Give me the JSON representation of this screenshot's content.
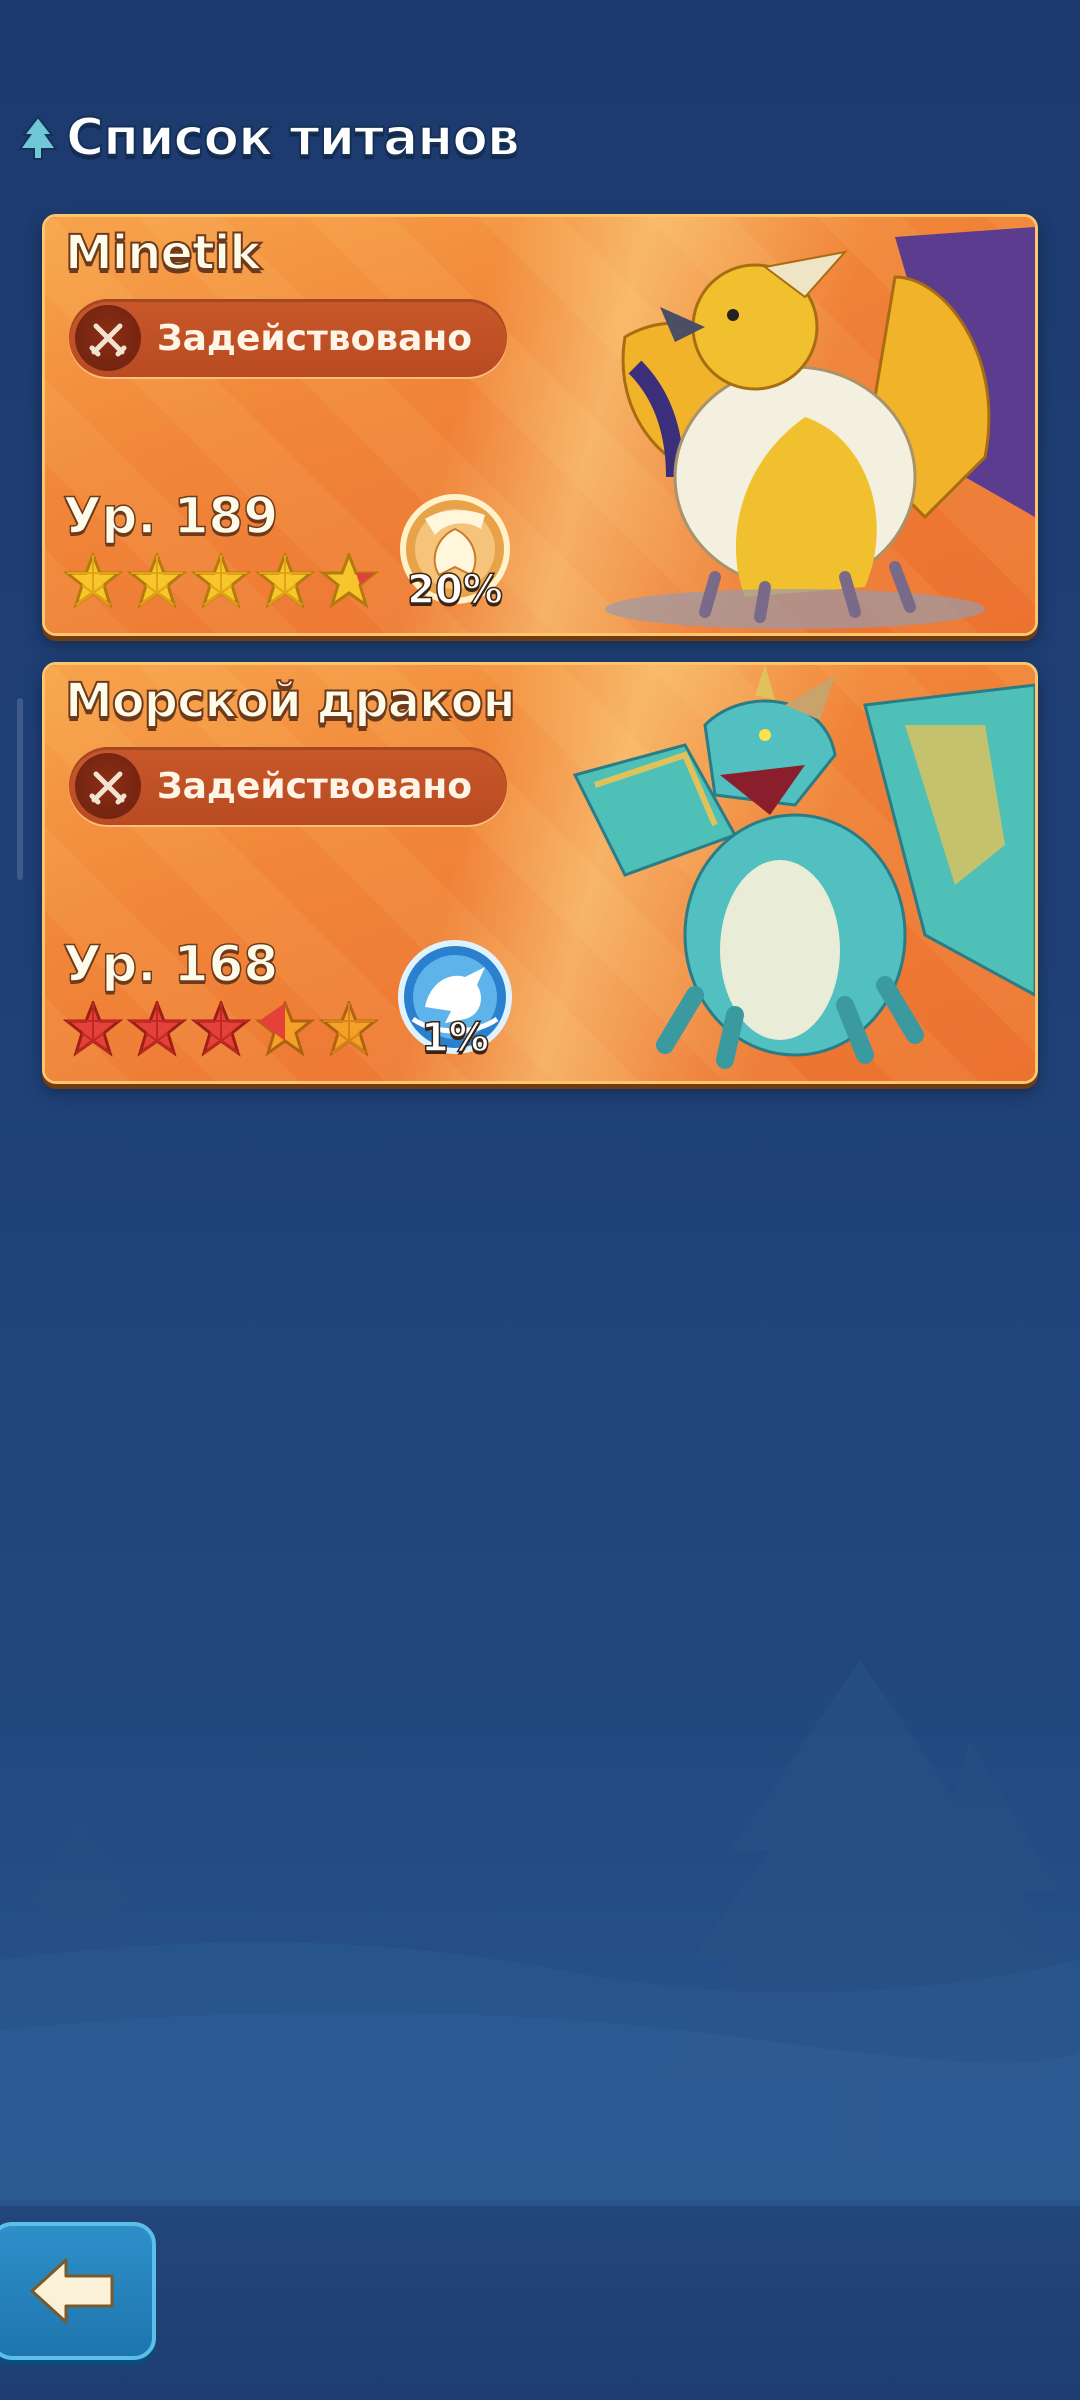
{
  "header": {
    "title": "Список титанов",
    "icon": "tree-icon"
  },
  "titans": [
    {
      "name": "Minetik",
      "status": "Задействовано",
      "status_icon": "crossed-swords-icon",
      "level": "Ур. 189",
      "stars": 5,
      "star_color": "gold",
      "element_icon": "phoenix-emblem-icon",
      "percent": "20%",
      "portrait": "griffin"
    },
    {
      "name": "Морской дракон",
      "status": "Задействовано",
      "status_icon": "crossed-swords-icon",
      "level": "Ур. 168",
      "stars": 5,
      "star_color": "red",
      "element_icon": "water-dragon-emblem-icon",
      "percent": "1%",
      "portrait": "sea-dragon"
    }
  ],
  "footer": {
    "back_icon": "back-arrow-icon"
  },
  "colors": {
    "background": "#1f4178",
    "card": "#f1873a",
    "accent": "#ffc56c"
  }
}
